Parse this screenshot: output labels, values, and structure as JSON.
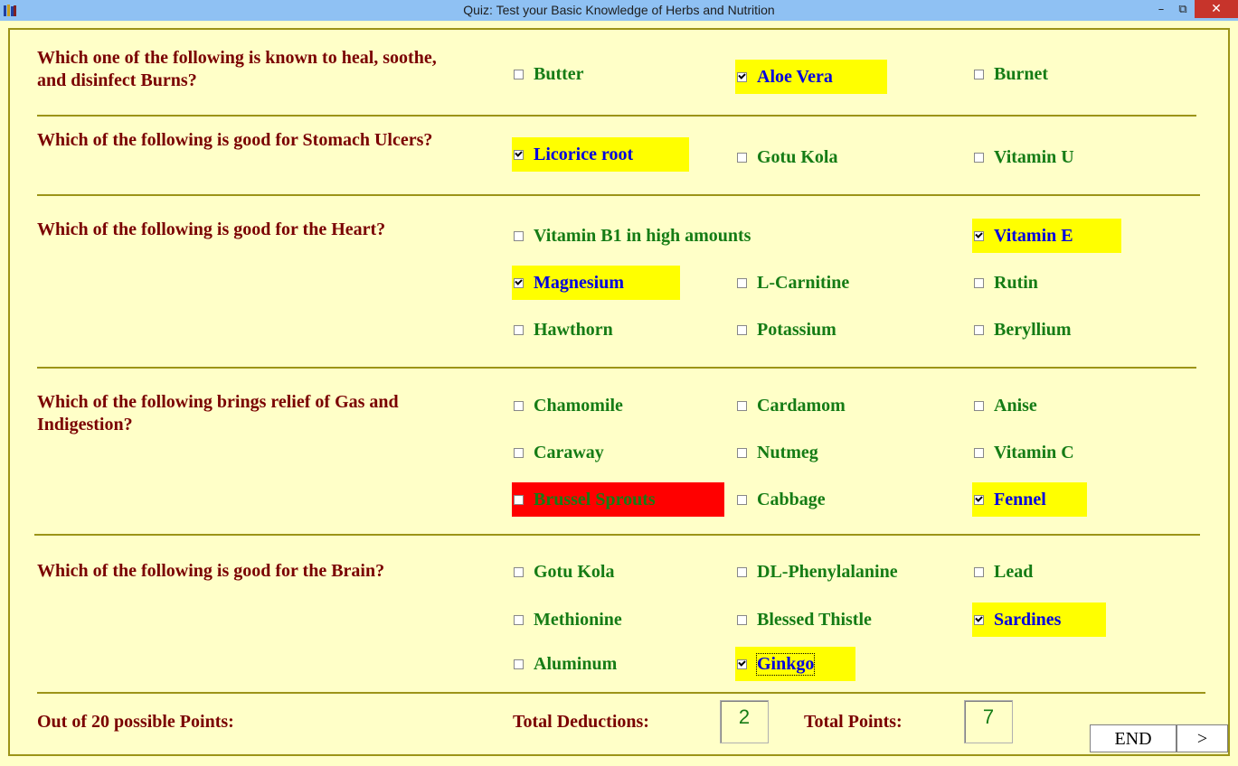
{
  "window": {
    "title": "Quiz: Test your Basic Knowledge of Herbs and Nutrition",
    "minimize_glyph": "–",
    "restore_glyph": "⧉",
    "close_glyph": "✕"
  },
  "questions": [
    {
      "text": "Which one of the following is known to heal, soothe, and disinfect Burns?",
      "options": [
        {
          "label": "Butter",
          "checked": false,
          "state": "normal"
        },
        {
          "label": "Aloe Vera",
          "checked": true,
          "state": "selected"
        },
        {
          "label": "Burnet",
          "checked": false,
          "state": "normal"
        }
      ]
    },
    {
      "text": "Which of the following is good for Stomach Ulcers?",
      "options": [
        {
          "label": "Licorice root",
          "checked": true,
          "state": "selected"
        },
        {
          "label": "Gotu Kola",
          "checked": false,
          "state": "normal"
        },
        {
          "label": "Vitamin U",
          "checked": false,
          "state": "normal"
        }
      ]
    },
    {
      "text": "Which of the following is good for the Heart?",
      "options": [
        {
          "label": "Vitamin B1 in high amounts",
          "checked": false,
          "state": "normal"
        },
        {
          "label": "Vitamin E",
          "checked": true,
          "state": "selected"
        },
        {
          "label": "Magnesium",
          "checked": true,
          "state": "selected"
        },
        {
          "label": "L-Carnitine",
          "checked": false,
          "state": "normal"
        },
        {
          "label": "Rutin",
          "checked": false,
          "state": "normal"
        },
        {
          "label": "Hawthorn",
          "checked": false,
          "state": "normal"
        },
        {
          "label": "Potassium",
          "checked": false,
          "state": "normal"
        },
        {
          "label": "Beryllium",
          "checked": false,
          "state": "normal"
        }
      ]
    },
    {
      "text": "Which of the following brings relief of Gas and Indigestion?",
      "options": [
        {
          "label": "Chamomile",
          "checked": false,
          "state": "normal"
        },
        {
          "label": "Cardamom",
          "checked": false,
          "state": "normal"
        },
        {
          "label": "Anise",
          "checked": false,
          "state": "normal"
        },
        {
          "label": "Caraway",
          "checked": false,
          "state": "normal"
        },
        {
          "label": "Nutmeg",
          "checked": false,
          "state": "normal"
        },
        {
          "label": "Vitamin C",
          "checked": false,
          "state": "normal"
        },
        {
          "label": "Brussel Sprouts",
          "checked": false,
          "state": "wrong"
        },
        {
          "label": "Cabbage",
          "checked": false,
          "state": "normal"
        },
        {
          "label": "Fennel",
          "checked": true,
          "state": "selected"
        }
      ]
    },
    {
      "text": "Which of the following is good for the Brain?",
      "options": [
        {
          "label": "Gotu Kola",
          "checked": false,
          "state": "normal"
        },
        {
          "label": "DL-Phenylalanine",
          "checked": false,
          "state": "normal"
        },
        {
          "label": "Lead",
          "checked": false,
          "state": "normal"
        },
        {
          "label": "Methionine",
          "checked": false,
          "state": "normal"
        },
        {
          "label": "Blessed Thistle",
          "checked": false,
          "state": "normal"
        },
        {
          "label": "Sardines",
          "checked": true,
          "state": "selected"
        },
        {
          "label": "Aluminum",
          "checked": false,
          "state": "normal"
        },
        {
          "label": "Ginkgo",
          "checked": true,
          "state": "selected"
        }
      ]
    }
  ],
  "footer": {
    "possible_points_label": "Out of 20 possible Points:",
    "deductions_label": "Total Deductions:",
    "deductions_value": "2",
    "points_label": "Total Points:",
    "points_value": "7",
    "end_button": "END",
    "next_button": ">"
  }
}
